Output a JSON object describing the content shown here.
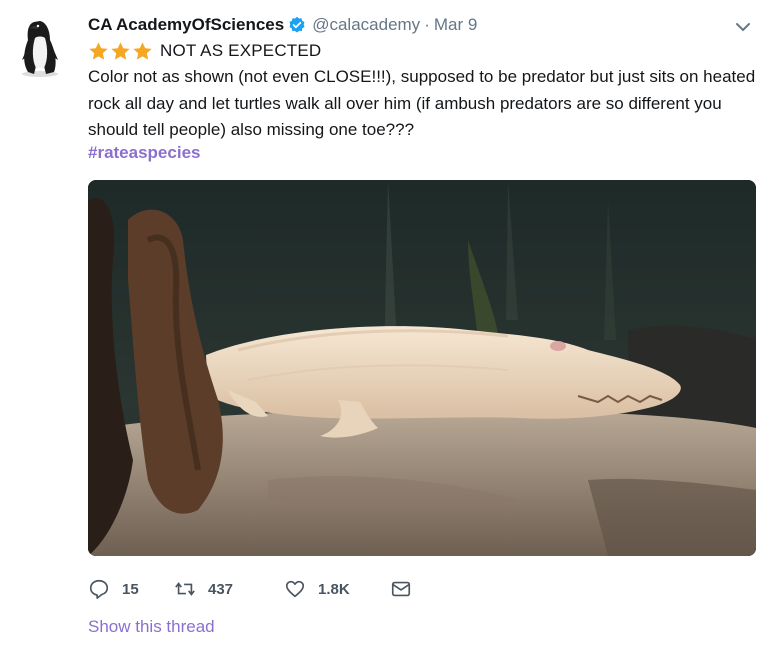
{
  "tweet": {
    "display_name": "CA AcademyOfSciences",
    "handle": "@calacademy",
    "separator": "·",
    "date": "Mar 9",
    "rating_text": "NOT AS EXPECTED",
    "star_count": 3,
    "body": "Color not as shown (not even CLOSE!!!), supposed to be predator but just sits on heated rock all day and let turtles walk all over him (if ambush predators are so different you should tell people) also missing one toe???",
    "hashtag": "#rateaspecies"
  },
  "actions": {
    "reply_count": "15",
    "retweet_count": "437",
    "like_count": "1.8K"
  },
  "show_thread": "Show this thread",
  "colors": {
    "link": "#8b6fd0",
    "verified": "#1da1f2",
    "star": "#f5a623",
    "muted": "#657786"
  },
  "icons": [
    "penguin-avatar",
    "verified-badge-icon",
    "caret-down-icon",
    "star-icon",
    "reply-icon",
    "retweet-icon",
    "like-icon",
    "message-icon"
  ]
}
